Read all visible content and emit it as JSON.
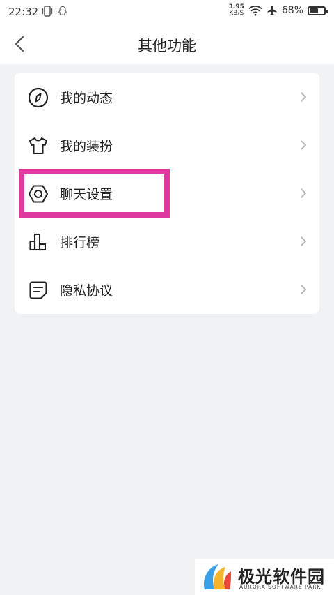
{
  "status_bar": {
    "time": "22:32",
    "net_speed_value": "3.95",
    "net_speed_unit": "KB/S",
    "battery_percent": "68%",
    "battery_level": 0.68
  },
  "header": {
    "title": "其他功能"
  },
  "menu": {
    "items": [
      {
        "label": "我的动态",
        "icon": "compass-icon"
      },
      {
        "label": "我的装扮",
        "icon": "tshirt-icon"
      },
      {
        "label": "聊天设置",
        "icon": "hex-nut-icon"
      },
      {
        "label": "排行榜",
        "icon": "bar-chart-icon"
      },
      {
        "label": "隐私协议",
        "icon": "document-icon"
      }
    ]
  },
  "highlight": {
    "color": "#de3aa0",
    "target": "聊天设置"
  },
  "watermark": {
    "title": "极光软件园",
    "subtitle": "AURORA SOFTWARE PARK"
  },
  "colors": {
    "background": "#f1f2f4",
    "card": "#ffffff",
    "text": "#222222",
    "chevron": "#b8b8b8"
  }
}
